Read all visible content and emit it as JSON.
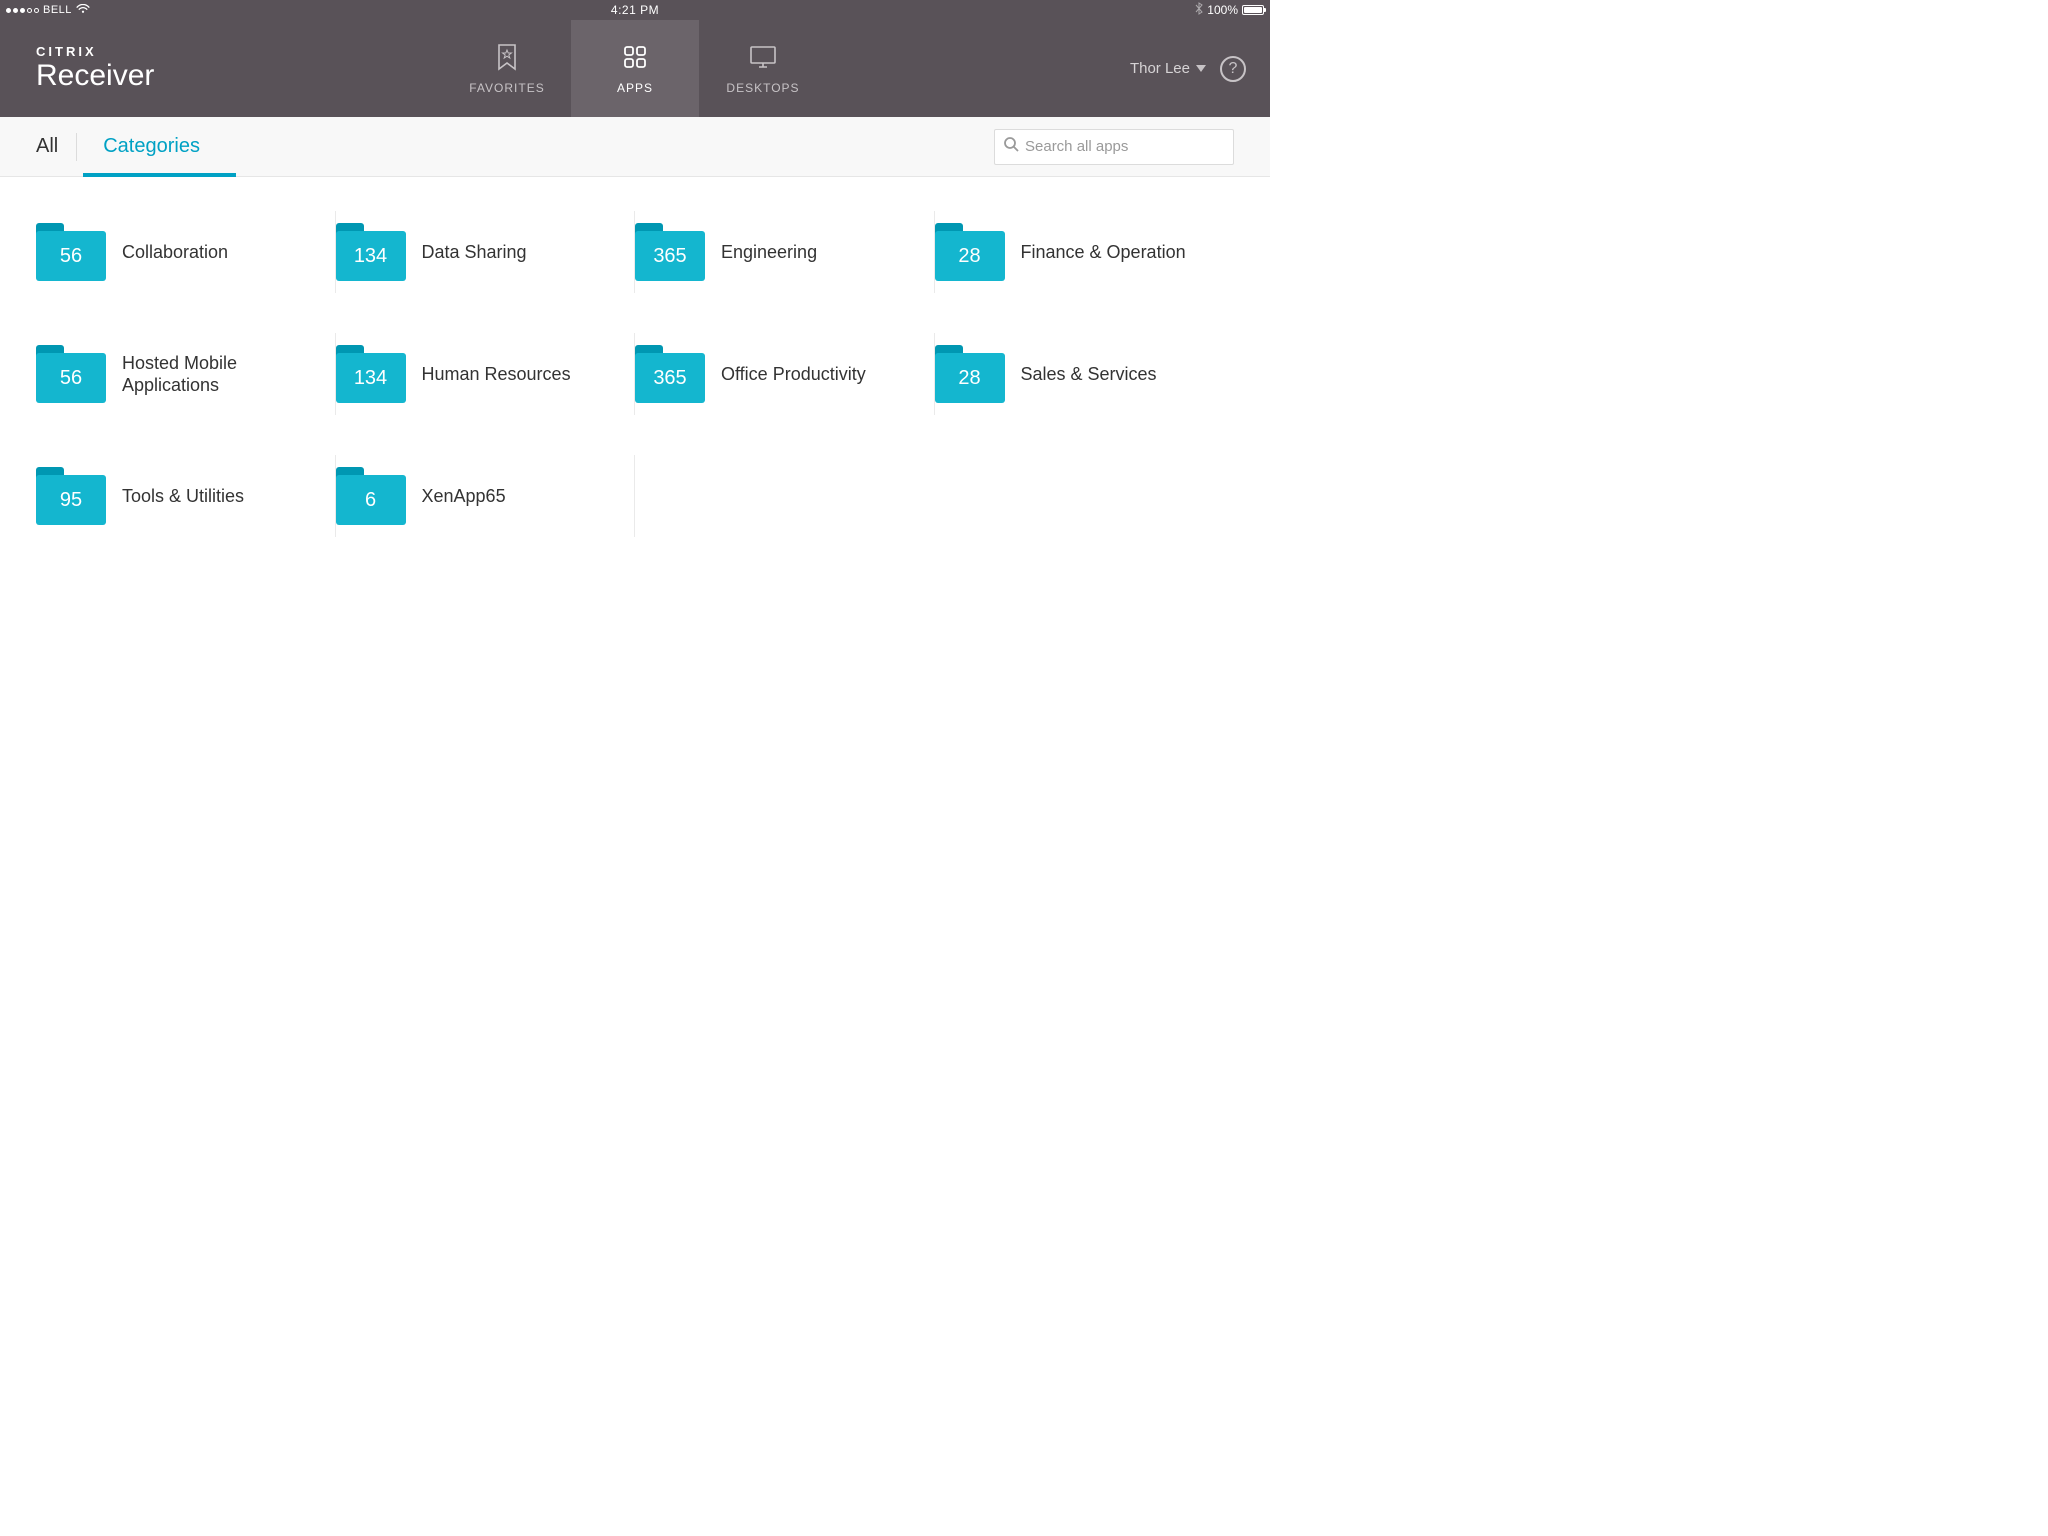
{
  "statusbar": {
    "carrier": "BELL",
    "time": "4:21 PM",
    "battery_pct": "100%"
  },
  "brand": {
    "line1": "CITRIX",
    "line2": "Receiver"
  },
  "nav": {
    "favorites": "FAVORITES",
    "apps": "APPS",
    "desktops": "DESKTOPS"
  },
  "user": {
    "name": "Thor Lee"
  },
  "subnav": {
    "all": "All",
    "categories": "Categories"
  },
  "search": {
    "placeholder": "Search all apps"
  },
  "categories": [
    {
      "count": "56",
      "label": "Collaboration"
    },
    {
      "count": "134",
      "label": "Data Sharing"
    },
    {
      "count": "365",
      "label": "Engineering"
    },
    {
      "count": "28",
      "label": "Finance & Operation"
    },
    {
      "count": "56",
      "label": "Hosted Mobile Applications"
    },
    {
      "count": "134",
      "label": "Human Resources"
    },
    {
      "count": "365",
      "label": "Office Productivity"
    },
    {
      "count": "28",
      "label": "Sales & Services"
    },
    {
      "count": "95",
      "label": "Tools & Utilities"
    },
    {
      "count": "6",
      "label": "XenApp65"
    }
  ]
}
